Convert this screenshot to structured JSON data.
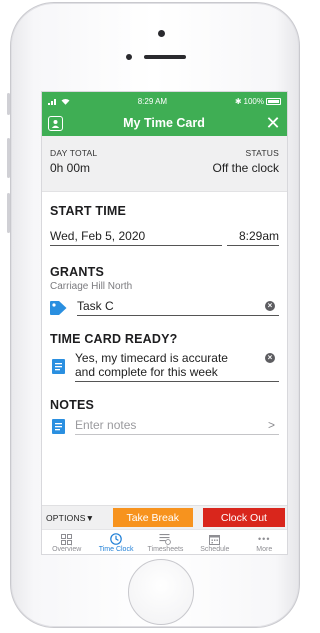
{
  "status_bar": {
    "time": "8:29 AM",
    "battery": "100%"
  },
  "nav": {
    "title": "My Time Card"
  },
  "summary": {
    "day_total_label": "DAY TOTAL",
    "day_total_value": "0h 00m",
    "status_label": "STATUS",
    "status_value": "Off the clock"
  },
  "start_time": {
    "title": "START TIME",
    "date": "Wed, Feb 5, 2020",
    "time": "8:29am"
  },
  "grants": {
    "title": "GRANTS",
    "subtitle": "Carriage Hill North",
    "task": "Task C"
  },
  "timecard_ready": {
    "title": "TIME CARD READY?",
    "line1": "Yes, my timecard is accurate",
    "line2": "and complete for this week"
  },
  "notes": {
    "title": "NOTES",
    "placeholder": "Enter notes"
  },
  "actions": {
    "options": "OPTIONS",
    "take_break": "Take Break",
    "clock_out": "Clock Out"
  },
  "tabs": [
    {
      "label": "Overview",
      "icon": "grid-icon"
    },
    {
      "label": "Time Clock",
      "icon": "clock-icon",
      "active": true
    },
    {
      "label": "Timesheets",
      "icon": "list-icon"
    },
    {
      "label": "Schedule",
      "icon": "calendar-icon"
    },
    {
      "label": "More",
      "icon": "more-icon"
    }
  ],
  "colors": {
    "header_green": "#3fae54",
    "break_orange": "#f7931e",
    "clockout_red": "#d9261c",
    "active_blue": "#1f7fd6",
    "icon_blue": "#2a8fe0"
  }
}
